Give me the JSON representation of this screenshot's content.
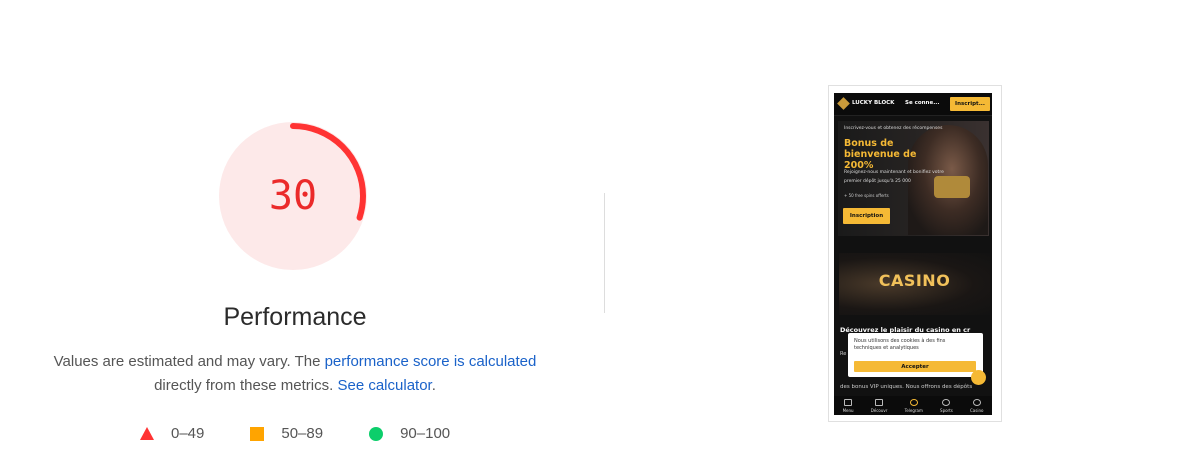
{
  "gauge": {
    "score": "30",
    "score_fraction": 0.3,
    "color": "#ff3333",
    "fill_color": "#fde9e9"
  },
  "category": {
    "title": "Performance"
  },
  "description": {
    "before": "Values are estimated and may vary. The ",
    "link1": "performance score is calculated",
    "middle": " directly from these metrics. ",
    "link2": "See calculator",
    "after": "."
  },
  "legend": [
    {
      "label": "0–49",
      "icon": "triangle-icon",
      "color": "#ff3333"
    },
    {
      "label": "50–89",
      "icon": "square-icon",
      "color": "#ffa400"
    },
    {
      "label": "90–100",
      "icon": "circle-icon",
      "color": "#0cce6b"
    }
  ],
  "screenshot": {
    "logo": "LUCKY BLOCK",
    "login": "Se conne...",
    "signup": "Inscript...",
    "kicker": "Inscrivez-vous et obtenez des récompenses",
    "bonus": "Bonus de bienvenue de 200%",
    "join": "Rejoignez-nous maintenant et bonifiez votre premier dépôt jusqu'à 25 000",
    "spins": "+ 50 free spins offerts",
    "hero_button": "Inscription",
    "casino": "CASINO",
    "discover": "Découvrez le plaisir du casino en cr",
    "side_r": "Re",
    "vip": "des bonus VIP uniques. Nous offrons des dépôts",
    "cookie_text": "Nous utilisons des cookies à des fins techniques et analytiques",
    "accept": "Accepter",
    "nav": [
      "Menu",
      "Découvr",
      "Telegram",
      "Sports",
      "Casino"
    ]
  }
}
